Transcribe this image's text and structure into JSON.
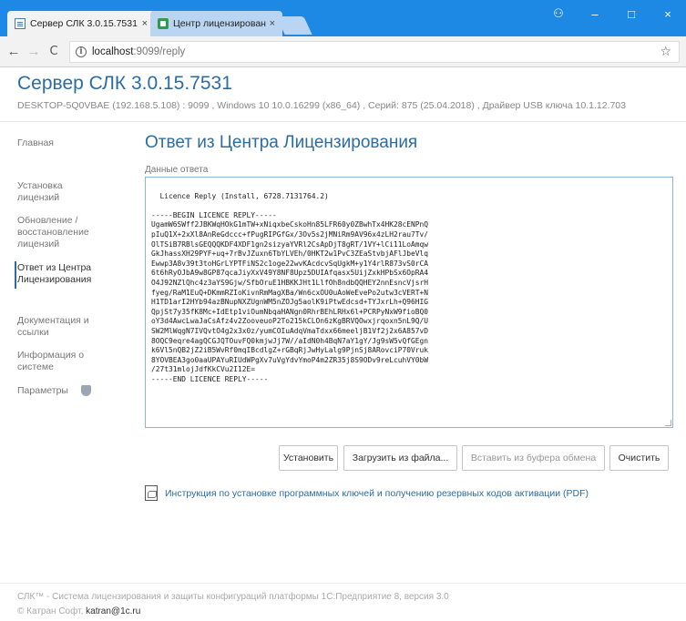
{
  "browser": {
    "tabs": [
      {
        "label": "Сервер СЛК 3.0.15.7531",
        "close": "×"
      },
      {
        "label": "Центр лицензирования",
        "close": "×"
      }
    ],
    "window_controls": {
      "profile": "⚇",
      "minimize": "–",
      "maximize": "□",
      "close": "×"
    },
    "nav": {
      "back": "←",
      "forward": "→",
      "reload": "C"
    },
    "url": {
      "host": "localhost",
      "rest": ":9099/reply"
    },
    "accent_color": "#1e88e5"
  },
  "header": {
    "title": "Сервер СЛК 3.0.15.7531",
    "sysinfo": "DESKTOP-5Q0VBAE (192.168.5.108) : 9099 ,  Windows 10 10.0.16299 (x86_64) ,  Серий: 875 (25.04.2018) ,  Драйвер USB ключа 10.1.12.703"
  },
  "sidebar": {
    "items": [
      {
        "label": "Главная"
      },
      {
        "label": "Установка\nлицензий"
      },
      {
        "label": "Обновление /\nвосстановление\nлицензий"
      },
      {
        "label": "Ответ из Центра\nЛицензирования"
      },
      {
        "label": "Документация и\nссылки"
      },
      {
        "label": "Информация о\nсистеме"
      },
      {
        "label": "Параметры"
      }
    ]
  },
  "main": {
    "page_title": "Ответ из Центра Лицензирования",
    "field_label": "Данные ответа",
    "reply_text": "Licence Reply (Install, 6728.7131764.2)\n\n-----BEGIN LICENCE REPLY-----\nUgamW6SWff2JBKWqHOkG1mTW+xNiqxbeCskoHn85LFR60y0ZBwhTx4HK28cENPnQ\npIuQ1X+2xXl8AnReGdccc+fPugRIPGfGx/3Ov5s2jMNiRm9AV96x4zLH2rau7Tv/\nOlTSiB7RBlsGEQQQKDF4XDF1gn2sizyaYVRl2CsApDjT8gRT/1VY+lCi11LoAmqw\nGkJhassXH29PYF+uq+7rBvJZuxn6TbYLVEh/0HKT2w1PvC3ZEaStvbjAFlJbeVlq\nEwwp3A8v39t3toHGrLYPTFiNS2c1oge22wvKAcdcvSqUgkM+y1Y4rlR873vS0rCA\n6t6hRyOJbA9w8GP87qcaJiyXxV49Y8NF8Upz5DUIAfqasx5UijZxkHPbSx6OpRA4\nO4J92NZlQhc4z3aYS9Gjw/SfbOruE1HBKKJHt1LlfOh8ndbQQHEY2nnEsncVjsrH\nfyeg/RaM1EuQ+DKmmRZIoKivnRmMagXBa/Wn6cxOU0uAoWeEvePo2utw3cVERT+N\nH1TD1arI2HYb94azBNupNXZUgnWM5nZOJg5aolK9iPtwEdcsd+TYJxrLh+Q96HIG\nQpjSt7y35fK8Mc+IdEtp1viOumNbqaHANgn0RhrBEhLRHx6l+PCRPyNxW9fioBQ0\noY3d4AwcLwaJaCsAfz4v2ZooveuoP2To215kCLOn6zKgBRVQOwxjrqoxn5nL9Q/U\nSW2MlWqgN7IVQvtO4g2x3x0z/yumCOIuAdqVmaTdxx66meeljB1Vf2j2x6A857vD\n8OQC9eqre4agQCGJQTOuvFQ0kmjwJj7W//aIdN0h4BqN7aY1gY/Jg9sW5vQfGEgn\nk6Vl5nQB2jZ2iB5WvRf0mqIBcdlgZ+rGBqRjJwHyLalg9PjnSj8ARovciP70Vruk\n8YOVBEA3go0aaUPAYuRIUdWPgXv7uVgYdvYmoP4m2ZR35j8S9ODv9reLcuhVY0bW\n/27t31mlojJdfKkCVu2I12E=\n-----END LICENCE REPLY-----"
  },
  "buttons": {
    "install": "Установить",
    "load_file": "Загрузить из файла...",
    "paste": "Вставить из буфера обмена",
    "clear": "Очистить"
  },
  "pdf_link": "Инструкция по установке программных ключей и получению резервных кодов активации (PDF)",
  "footer": {
    "line1": "СЛК™ - Система лицензирования и защиты конфигураций платформы 1С:Предприятие 8, версия 3.0",
    "copyright": "© Катран Софт,",
    "email": "katran@1c.ru"
  },
  "colors": {
    "link": "#2d6ca2",
    "accent": "#1e88e5"
  }
}
